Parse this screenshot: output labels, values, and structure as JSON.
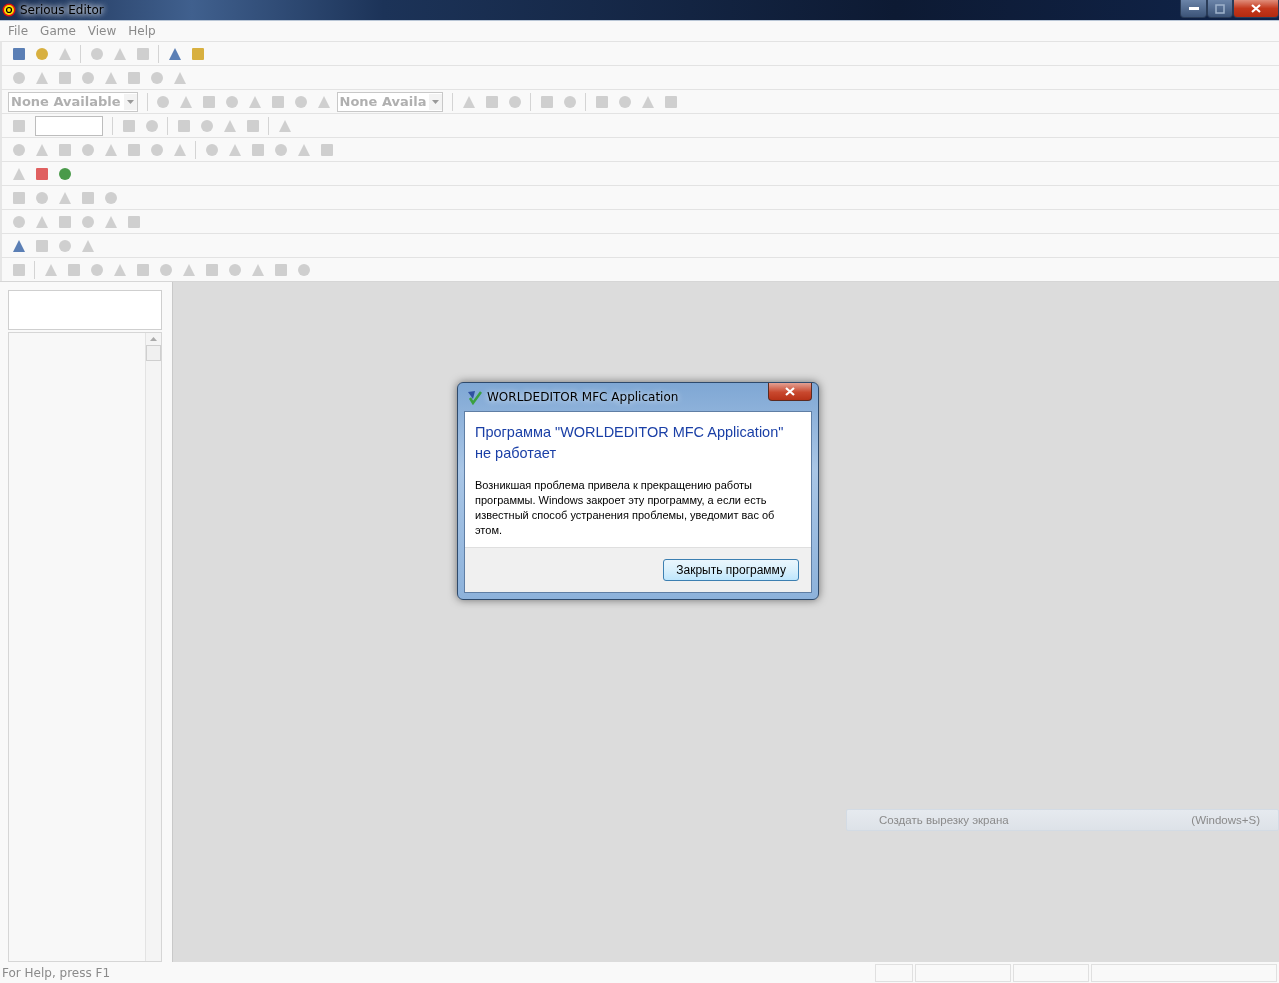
{
  "window": {
    "title": "Serious Editor"
  },
  "menu": [
    "File",
    "Game",
    "View",
    "Help"
  ],
  "toolbars": [
    [
      {
        "kind": "icon",
        "disabled": false
      },
      {
        "kind": "icon",
        "disabled": false
      },
      {
        "kind": "icon",
        "disabled": true
      },
      {
        "kind": "separator"
      },
      {
        "kind": "icon",
        "disabled": true
      },
      {
        "kind": "icon",
        "disabled": true
      },
      {
        "kind": "icon",
        "disabled": true
      },
      {
        "kind": "separator"
      },
      {
        "kind": "icon",
        "disabled": false
      },
      {
        "kind": "icon",
        "disabled": false
      }
    ],
    [
      {
        "kind": "icon",
        "disabled": true
      },
      {
        "kind": "icon",
        "disabled": true
      },
      {
        "kind": "icon",
        "disabled": true
      },
      {
        "kind": "icon",
        "disabled": true
      },
      {
        "kind": "icon",
        "disabled": true
      },
      {
        "kind": "icon",
        "disabled": true
      },
      {
        "kind": "icon",
        "disabled": true
      },
      {
        "kind": "icon",
        "disabled": true
      }
    ],
    [
      {
        "kind": "combo",
        "value": "None Available"
      },
      {
        "kind": "separator"
      },
      {
        "kind": "icon",
        "disabled": true
      },
      {
        "kind": "icon",
        "disabled": true
      },
      {
        "kind": "icon",
        "disabled": true
      },
      {
        "kind": "icon",
        "disabled": true
      },
      {
        "kind": "icon",
        "disabled": true
      },
      {
        "kind": "icon",
        "disabled": true
      },
      {
        "kind": "icon",
        "disabled": true
      },
      {
        "kind": "icon",
        "disabled": true
      },
      {
        "kind": "combo",
        "value": "None Availa"
      },
      {
        "kind": "separator"
      },
      {
        "kind": "icon",
        "disabled": true
      },
      {
        "kind": "icon",
        "disabled": true
      },
      {
        "kind": "icon",
        "disabled": true
      },
      {
        "kind": "separator"
      },
      {
        "kind": "icon",
        "disabled": true
      },
      {
        "kind": "icon",
        "disabled": true
      },
      {
        "kind": "separator"
      },
      {
        "kind": "icon",
        "disabled": true
      },
      {
        "kind": "icon",
        "disabled": true
      },
      {
        "kind": "icon",
        "disabled": true
      },
      {
        "kind": "icon",
        "disabled": true
      }
    ],
    [
      {
        "kind": "icon",
        "disabled": true
      },
      {
        "kind": "field"
      },
      {
        "kind": "separator"
      },
      {
        "kind": "icon",
        "disabled": true
      },
      {
        "kind": "icon",
        "disabled": true
      },
      {
        "kind": "separator"
      },
      {
        "kind": "icon",
        "disabled": true
      },
      {
        "kind": "icon",
        "disabled": true
      },
      {
        "kind": "icon",
        "disabled": true
      },
      {
        "kind": "icon",
        "disabled": true
      },
      {
        "kind": "separator"
      },
      {
        "kind": "icon",
        "disabled": true
      }
    ],
    [
      {
        "kind": "icon",
        "disabled": true
      },
      {
        "kind": "icon",
        "disabled": true
      },
      {
        "kind": "icon",
        "disabled": true
      },
      {
        "kind": "icon",
        "disabled": true
      },
      {
        "kind": "icon",
        "disabled": true
      },
      {
        "kind": "icon",
        "disabled": true
      },
      {
        "kind": "icon",
        "disabled": true
      },
      {
        "kind": "icon",
        "disabled": true
      },
      {
        "kind": "separator"
      },
      {
        "kind": "icon",
        "disabled": true
      },
      {
        "kind": "icon",
        "disabled": true
      },
      {
        "kind": "icon",
        "disabled": true
      },
      {
        "kind": "icon",
        "disabled": true
      },
      {
        "kind": "icon",
        "disabled": true
      },
      {
        "kind": "icon",
        "disabled": true
      }
    ],
    [
      {
        "kind": "icon",
        "disabled": true
      },
      {
        "kind": "icon",
        "disabled": false
      },
      {
        "kind": "icon",
        "disabled": false
      }
    ],
    [
      {
        "kind": "icon",
        "disabled": true
      },
      {
        "kind": "icon",
        "disabled": true
      },
      {
        "kind": "icon",
        "disabled": true
      },
      {
        "kind": "icon",
        "disabled": true
      },
      {
        "kind": "icon",
        "disabled": true
      }
    ],
    [
      {
        "kind": "icon",
        "disabled": true
      },
      {
        "kind": "icon",
        "disabled": true
      },
      {
        "kind": "icon",
        "disabled": true
      },
      {
        "kind": "icon",
        "disabled": true
      },
      {
        "kind": "icon",
        "disabled": true
      },
      {
        "kind": "icon",
        "disabled": true
      }
    ],
    [
      {
        "kind": "icon",
        "disabled": false
      },
      {
        "kind": "icon",
        "disabled": true
      },
      {
        "kind": "icon",
        "disabled": true
      },
      {
        "kind": "icon",
        "disabled": true
      }
    ],
    [
      {
        "kind": "icon",
        "disabled": true
      },
      {
        "kind": "separator"
      },
      {
        "kind": "icon",
        "disabled": true
      },
      {
        "kind": "icon",
        "disabled": true
      },
      {
        "kind": "icon",
        "disabled": true
      },
      {
        "kind": "icon",
        "disabled": true
      },
      {
        "kind": "icon",
        "disabled": true
      },
      {
        "kind": "icon",
        "disabled": true
      },
      {
        "kind": "icon",
        "disabled": true
      },
      {
        "kind": "icon",
        "disabled": true
      },
      {
        "kind": "icon",
        "disabled": true
      },
      {
        "kind": "icon",
        "disabled": true
      },
      {
        "kind": "icon",
        "disabled": true
      },
      {
        "kind": "icon",
        "disabled": true
      }
    ]
  ],
  "status_bar": {
    "text": "For Help, press F1"
  },
  "dialog": {
    "title": "WORLDEDITOR MFC Application",
    "heading": "Программа \"WORLDEDITOR MFC Application\" не работает",
    "message": "Возникшая проблема привела к прекращению работы программы. Windows закроет эту программу, а если есть известный способ устранения проблемы, уведомит вас об этом.",
    "button": "Закрыть программу"
  },
  "snip_tooltip": {
    "label": "Создать вырезку экрана",
    "shortcut": "(Windows+S)"
  }
}
